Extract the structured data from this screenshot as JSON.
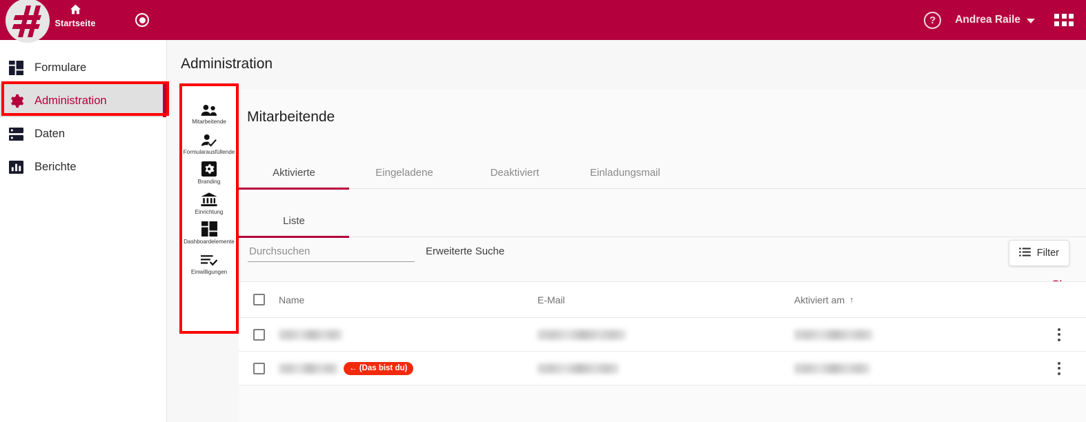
{
  "header": {
    "logo_icon": "hash-logo-icon",
    "home_label": "Startseite",
    "home_icon": "home-icon",
    "record_icon": "record-circle-icon",
    "help_icon": "help-circle-icon",
    "user_name": "Andrea Raile",
    "user_chevron_icon": "chevron-down-icon",
    "apps_icon": "apps-grid-icon",
    "brand_color": "#B4003C"
  },
  "sidebar": {
    "items": [
      {
        "label": "Formulare",
        "icon": "forms-grid-icon",
        "active": false
      },
      {
        "label": "Administration",
        "icon": "gear-icon",
        "active": true
      },
      {
        "label": "Daten",
        "icon": "database-icon",
        "active": false
      },
      {
        "label": "Berichte",
        "icon": "bar-chart-icon",
        "active": false
      }
    ]
  },
  "icon_rail": {
    "items": [
      {
        "label": "Mitarbeitende",
        "icon": "people-icon"
      },
      {
        "label": "Formularausfüllende",
        "icon": "person-check-icon"
      },
      {
        "label": "Branding",
        "icon": "gear-square-icon"
      },
      {
        "label": "Einrichtung",
        "icon": "bank-icon"
      },
      {
        "label": "Dashboardelemente",
        "icon": "dashboard-grid-icon"
      },
      {
        "label": "Einwilligungen",
        "icon": "list-check-icon"
      }
    ]
  },
  "main": {
    "page_title": "Administration",
    "card_title": "Mitarbeitende",
    "tabs_primary": [
      {
        "label": "Aktivierte",
        "active": true
      },
      {
        "label": "Eingeladene",
        "active": false
      },
      {
        "label": "Deaktiviert",
        "active": false
      },
      {
        "label": "Einladungsmail",
        "active": false
      }
    ],
    "tabs_secondary": [
      {
        "label": "Liste",
        "active": true
      }
    ],
    "search": {
      "placeholder": "Durchsuchen",
      "value": "",
      "advanced_label": "Erweiterte Suche"
    },
    "filter_button": {
      "label": "Filter",
      "icon": "filter-list-icon"
    },
    "refresh_button": {
      "icon": "refresh-icon",
      "color": "#C2003F"
    },
    "table": {
      "columns": [
        {
          "key": "name",
          "label": "Name"
        },
        {
          "key": "email",
          "label": "E-Mail"
        },
        {
          "key": "activated",
          "label": "Aktiviert am",
          "sort": "asc",
          "sort_icon": "arrow-up-icon"
        }
      ],
      "rows": [
        {
          "name": "",
          "email": "",
          "activated": "",
          "redacted": true,
          "is_you": false
        },
        {
          "name": "",
          "email": "",
          "activated": "",
          "redacted": true,
          "is_you": true
        }
      ],
      "you_badge_label": "← (Das bist du)"
    }
  },
  "annotations": {
    "color": "#FF0000",
    "boxes": [
      {
        "name": "sidebar-administration-highlight"
      },
      {
        "name": "icon-rail-highlight"
      }
    ]
  }
}
